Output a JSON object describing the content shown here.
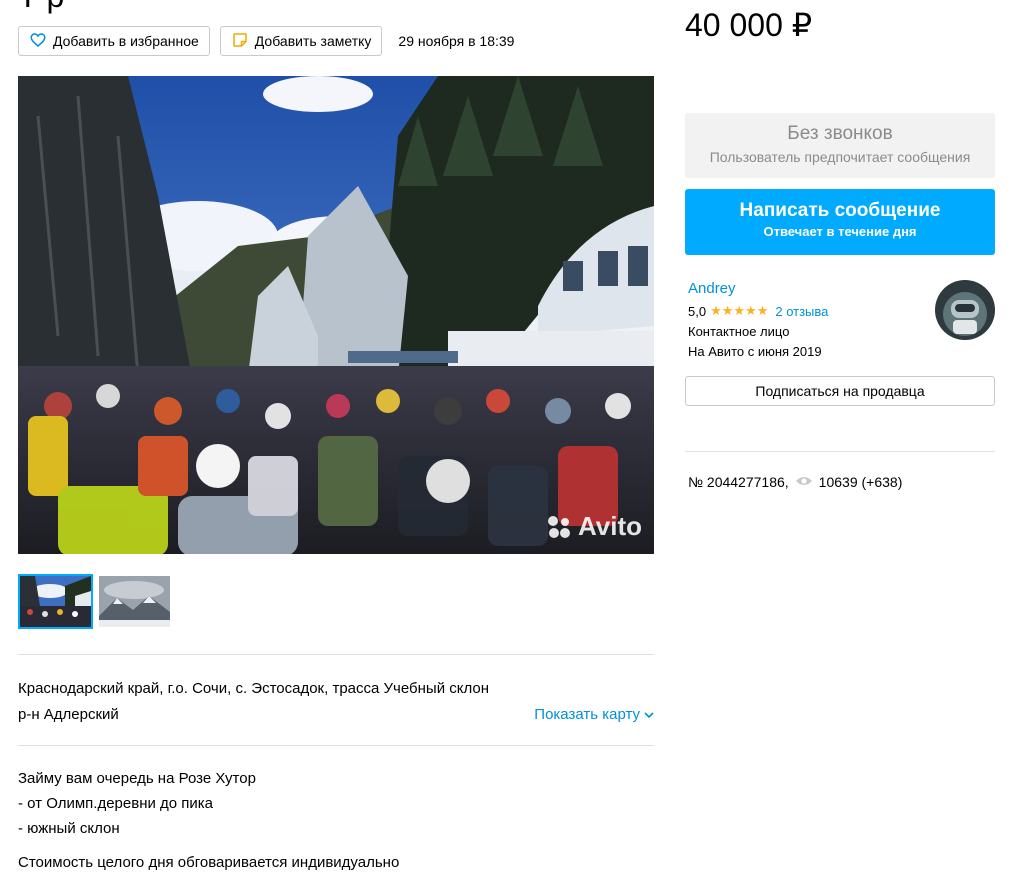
{
  "actions": {
    "favorite_label": "Добавить в избранное",
    "note_label": "Добавить заметку",
    "published": "29 ноября в 18:39"
  },
  "gallery": {
    "watermark": "Avito",
    "thumbnail_count": 2,
    "active_index": 0
  },
  "address": {
    "line1": "Краснодарский край, г.о. Сочи, с. Эстосадок, трасса Учебный склон",
    "line2": "р-н Адлерский",
    "show_map": "Показать карту"
  },
  "description": {
    "lines": [
      "Займу вам очередь на Розе Хутор",
      "- от Олимп.деревни до пика",
      "- южный склон"
    ],
    "last": "Стоимость целого дня обговаривается индивидуально"
  },
  "price": "40 000 ₽",
  "contact": {
    "no_calls_title": "Без звонков",
    "no_calls_sub": "Пользователь предпочитает сообщения",
    "write_title": "Написать сообщение",
    "write_sub": "Отвечает в течение дня"
  },
  "seller": {
    "name": "Andrey",
    "rating": "5,0",
    "stars": "★★★★★",
    "reviews": "2 отзыва",
    "role": "Контактное лицо",
    "since": "На Авито с июня 2019",
    "subscribe": "Подписаться на продавца"
  },
  "meta": {
    "item_number": "№ 2044277186,",
    "views": "10639 (+638)"
  },
  "colors": {
    "accent": "#00aaff",
    "link": "#0091d9",
    "star": "#ffb021"
  }
}
